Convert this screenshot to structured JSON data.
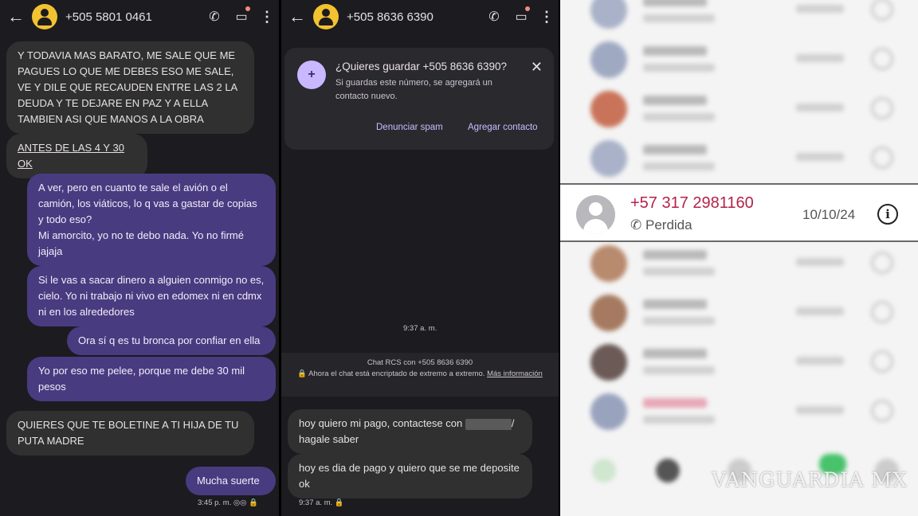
{
  "left_chat": {
    "contact": "+505 5801 0461",
    "messages": [
      "Y TODAVIA MAS BARATO, ME SALE QUE ME PAGUES LO QUE ME DEBES ESO ME SALE, VE Y DILE QUE RECAUDEN ENTRE LAS 2 LA DEUDA Y TE DEJARE EN PAZ Y A ELLA TAMBIEN ASI QUE MANOS A LA OBRA",
      "ANTES DE LAS 4 Y 30 OK",
      "A ver, pero en cuanto te sale el avión o el camión, los viáticos, lo q vas a gastar de copias y todo eso?\nMi amorcito, yo no te debo nada. Yo no firmé jajaja",
      "Si le vas a sacar dinero a alguien conmigo no es, cielo. Yo ni trabajo ni vivo en edomex ni en cdmx ni en los alrededores",
      "Ora sí q es tu bronca por confiar en ella",
      "Yo por eso me pelee, porque me debe 30 mil pesos",
      "QUIERES QUE TE BOLETINE A TI HIJA DE TU PUTA MADRE",
      "Mucha suerte"
    ],
    "last_time": "3:45 p. m."
  },
  "middle_chat": {
    "contact": "+505 8636 6390",
    "save_card": {
      "title": "¿Quieres guardar +505 8636 6390?",
      "desc": "Si guardas este número, se agregará un contacto nuevo.",
      "spam_label": "Denunciar spam",
      "add_label": "Agregar contacto"
    },
    "time1": "9:37 a. m.",
    "rcs_line1": "Chat RCS con +505 8636 6390",
    "rcs_line2": "Ahora el chat está encriptado de extremo a extremo.",
    "rcs_link": "Más información",
    "msg1_a": "hoy quiero mi pago, contactese con",
    "msg1_b": "/ hagale saber",
    "msg2": "hoy es dia de pago y quiero que se me deposite ok",
    "time2": "9:37 a. m."
  },
  "call_log": {
    "number": "+57 317 2981160",
    "status": "Perdida",
    "date": "10/10/24",
    "watermark": "VANGUARDIA MX"
  },
  "colors": {
    "incoming": "#303030",
    "outgoing": "#493b80",
    "missed": "#b3224a"
  }
}
